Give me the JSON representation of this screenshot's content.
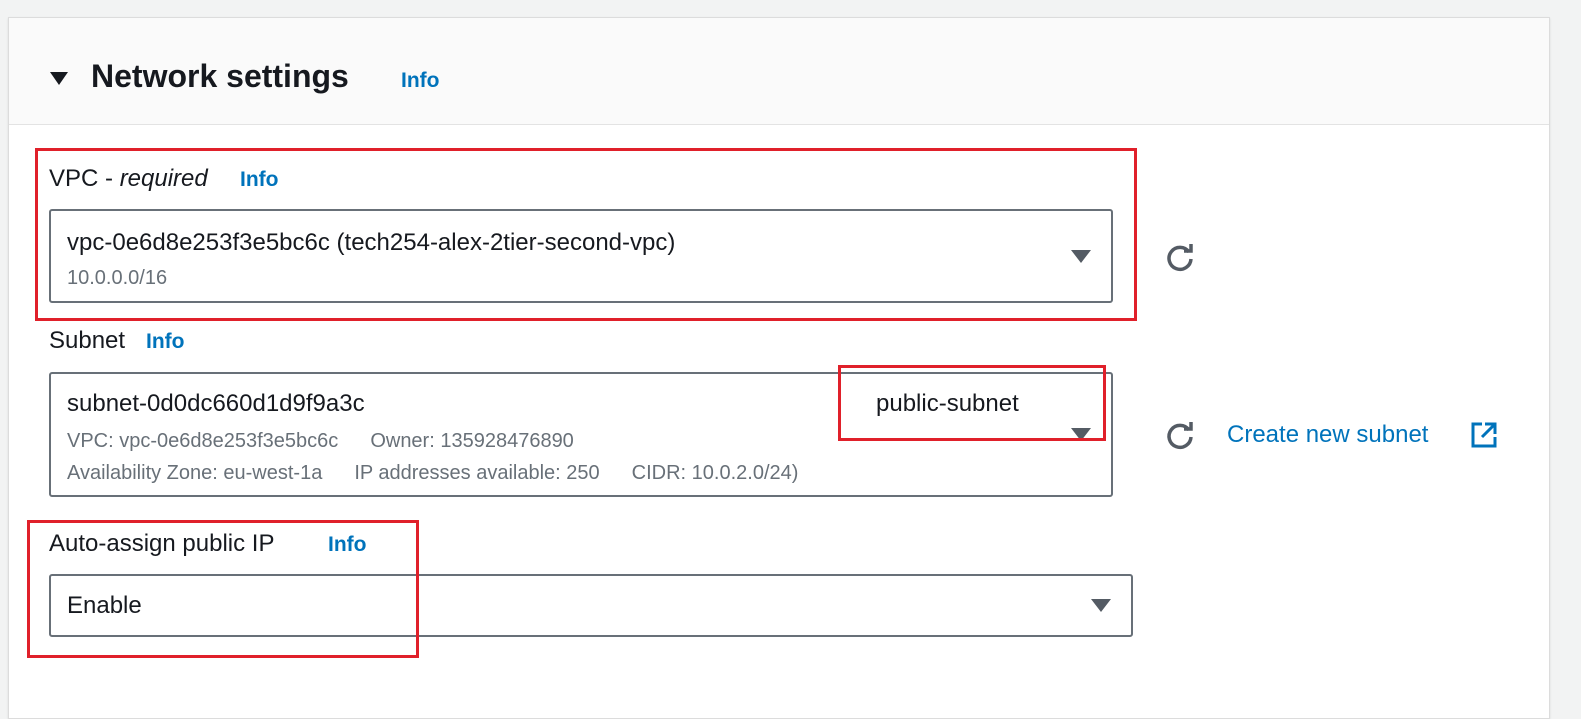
{
  "section": {
    "title": "Network settings",
    "info": "Info"
  },
  "vpc": {
    "label": "VPC - ",
    "label_required": "required",
    "info": "Info",
    "value": "vpc-0e6d8e253f3e5bc6c (tech254-alex-2tier-second-vpc)",
    "cidr": "10.0.0.0/16"
  },
  "subnet": {
    "label": "Subnet",
    "info": "Info",
    "value": "subnet-0d0dc660d1d9f9a3c",
    "name": "public-subnet",
    "vpc": "VPC: vpc-0e6d8e253f3e5bc6c",
    "owner": "Owner: 135928476890",
    "az": "Availability Zone: eu-west-1a",
    "ips": "IP addresses available: 250",
    "cidr": "CIDR: 10.0.2.0/24)",
    "create_link": "Create new subnet"
  },
  "public_ip": {
    "label": "Auto-assign public IP",
    "info": "Info",
    "value": "Enable"
  },
  "colors": {
    "accent": "#0073bb",
    "highlight": "#e0202a"
  }
}
